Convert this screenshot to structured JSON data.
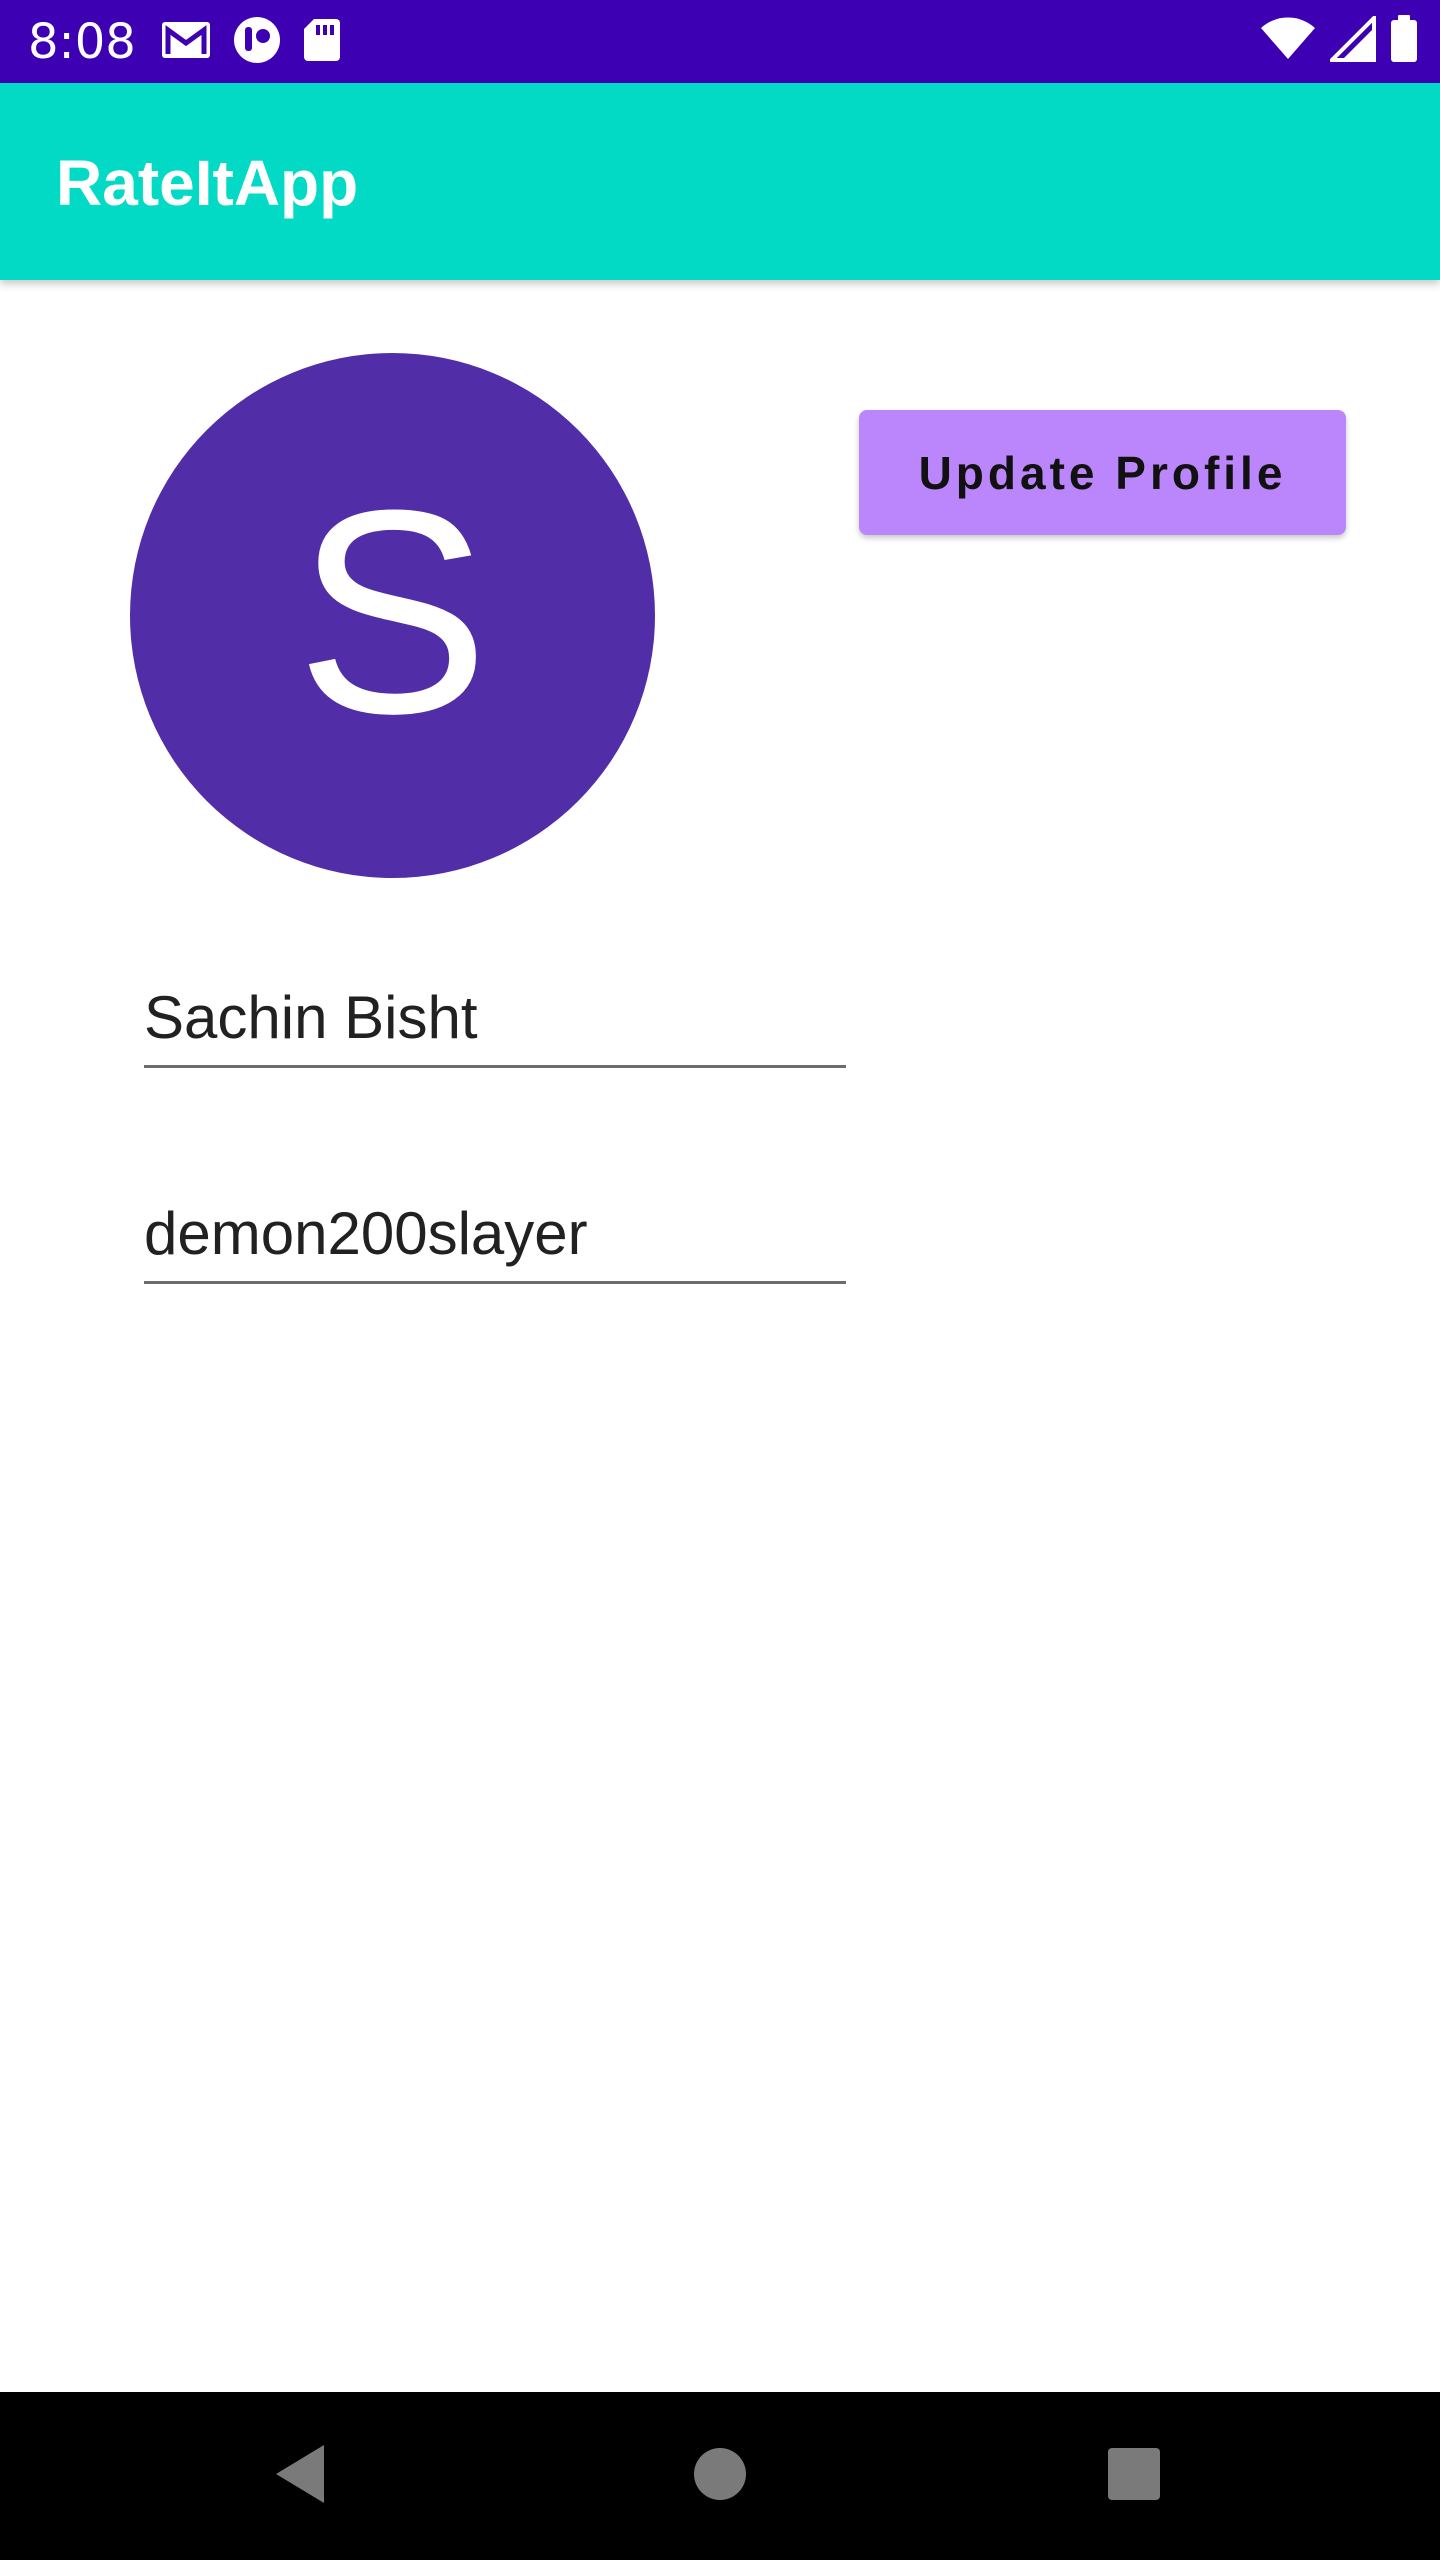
{
  "status_bar": {
    "time": "8:08",
    "left_icons": [
      "gmail-icon",
      "app-notification-icon",
      "sd-card-icon"
    ],
    "right_icons": [
      "wifi-icon",
      "cell-signal-icon",
      "battery-icon"
    ],
    "background_color": "#3d00b3"
  },
  "app_bar": {
    "title": "RateItApp",
    "background_color": "#03dac5"
  },
  "profile": {
    "avatar_letter": "S",
    "avatar_color": "#512da8",
    "update_button_label": "Update Profile",
    "update_button_color": "#bb86fc",
    "name_value": "Sachin Bisht",
    "username_value": "demon200slayer"
  },
  "nav_bar": {
    "buttons": [
      "back-icon",
      "home-icon",
      "recents-icon"
    ]
  }
}
